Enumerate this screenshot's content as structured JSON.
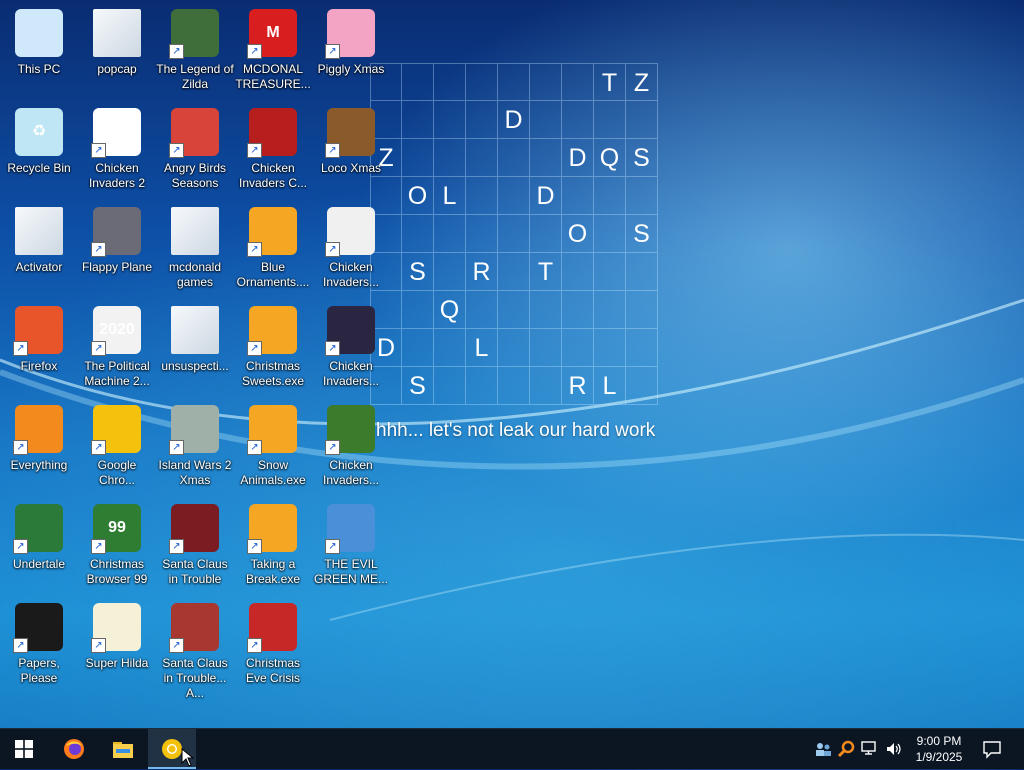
{
  "desktop": {
    "icons": [
      {
        "label": "This PC",
        "icon": "computer-icon",
        "color": "#cfe9fb",
        "glyph": "",
        "shortcut": false
      },
      {
        "label": "Recycle Bin",
        "icon": "recycle-bin-icon",
        "color": "#bfe6f5",
        "glyph": "♻",
        "shortcut": false
      },
      {
        "label": "Activator",
        "icon": "folder-icon",
        "color": "#e6eef5",
        "glyph": "",
        "shortcut": false
      },
      {
        "label": "Firefox",
        "icon": "firefox-icon",
        "color": "#e8552a",
        "glyph": "",
        "shortcut": true
      },
      {
        "label": "Everything",
        "icon": "magnifier-icon",
        "color": "#f28a1e",
        "glyph": "",
        "shortcut": true
      },
      {
        "label": "Undertale",
        "icon": "undertale-icon",
        "color": "#2c7a3a",
        "glyph": "",
        "shortcut": true
      },
      {
        "label": "Papers, Please",
        "icon": "papers-please-icon",
        "color": "#1a1a1a",
        "glyph": "",
        "shortcut": true
      },
      {
        "label": "popcap",
        "icon": "folder-icon",
        "color": "#e6eef5",
        "glyph": "",
        "shortcut": false
      },
      {
        "label": "Chicken Invaders 2",
        "icon": "chicken-icon",
        "color": "#ffffff",
        "glyph": "2",
        "shortcut": true
      },
      {
        "label": "Flappy Plane",
        "icon": "flappy-plane-icon",
        "color": "#6b6b78",
        "glyph": "",
        "shortcut": true
      },
      {
        "label": "The Political Machine 2...",
        "icon": "political-machine-icon",
        "color": "#f2f2f2",
        "glyph": "2020",
        "shortcut": true
      },
      {
        "label": "Google Chro...",
        "icon": "chrome-icon",
        "color": "#f4c20d",
        "glyph": "",
        "shortcut": true
      },
      {
        "label": "Christmas Browser 99",
        "icon": "christmas-tree-icon",
        "color": "#2f7d32",
        "glyph": "99",
        "shortcut": true
      },
      {
        "label": "Super Hilda",
        "icon": "super-hilda-icon",
        "color": "#f5f0d8",
        "glyph": "",
        "shortcut": true
      },
      {
        "label": "The Legend of Zilda",
        "icon": "zilda-icon",
        "color": "#3f6e3a",
        "glyph": "",
        "shortcut": true
      },
      {
        "label": "Angry Birds Seasons",
        "icon": "angry-birds-icon",
        "color": "#d8443a",
        "glyph": "",
        "shortcut": true
      },
      {
        "label": "mcdonald games",
        "icon": "folder-icon",
        "color": "#e6eef5",
        "glyph": "",
        "shortcut": false
      },
      {
        "label": "unsuspecti...",
        "icon": "folder-icon",
        "color": "#e6eef5",
        "glyph": "",
        "shortcut": false
      },
      {
        "label": "Island Wars 2 Xmas",
        "icon": "island-wars-icon",
        "color": "#9fb0a8",
        "glyph": "",
        "shortcut": true
      },
      {
        "label": "Santa Claus in Trouble",
        "icon": "santa-icon",
        "color": "#7a1c22",
        "glyph": "",
        "shortcut": true
      },
      {
        "label": "Santa Claus in Trouble... A...",
        "icon": "santa-icon",
        "color": "#a8382f",
        "glyph": "",
        "shortcut": true
      },
      {
        "label": "MCDONAL TREASURE...",
        "icon": "mcdonalds-icon",
        "color": "#d81e1e",
        "glyph": "M",
        "shortcut": true
      },
      {
        "label": "Chicken Invaders C...",
        "icon": "snowman-icon",
        "color": "#b71f1f",
        "glyph": "",
        "shortcut": true
      },
      {
        "label": "Blue Ornaments....",
        "icon": "puzzle-icon",
        "color": "#f5a623",
        "glyph": "",
        "shortcut": true
      },
      {
        "label": "Christmas Sweets.exe",
        "icon": "puzzle-icon",
        "color": "#f5a623",
        "glyph": "",
        "shortcut": true
      },
      {
        "label": "Snow Animals.exe",
        "icon": "puzzle-icon",
        "color": "#f5a623",
        "glyph": "",
        "shortcut": true
      },
      {
        "label": "Taking a Break.exe",
        "icon": "puzzle-icon",
        "color": "#f5a623",
        "glyph": "",
        "shortcut": true
      },
      {
        "label": "Christmas Eve Crisis",
        "icon": "santa-face-icon",
        "color": "#c62828",
        "glyph": "",
        "shortcut": true
      },
      {
        "label": "Piggly Xmas",
        "icon": "pig-icon",
        "color": "#f3a3c3",
        "glyph": "",
        "shortcut": true
      },
      {
        "label": "Loco Xmas",
        "icon": "bear-icon",
        "color": "#8b5a2b",
        "glyph": "",
        "shortcut": true
      },
      {
        "label": "Chicken Invaders...",
        "icon": "chicken-icon",
        "color": "#f0f0f0",
        "glyph": "",
        "shortcut": true
      },
      {
        "label": "Chicken Invaders...",
        "icon": "chicken-icon",
        "color": "#2a2540",
        "glyph": "",
        "shortcut": true
      },
      {
        "label": "Chicken Invaders...",
        "icon": "chicken-icon",
        "color": "#3c7a2c",
        "glyph": "",
        "shortcut": true
      },
      {
        "label": "THE EVIL GREEN ME...",
        "icon": "messenger-icon",
        "color": "#4a90d9",
        "glyph": "",
        "shortcut": true
      }
    ]
  },
  "grid": {
    "rows": [
      [
        "",
        "",
        "",
        "",
        "",
        "",
        "",
        "T",
        "Z"
      ],
      [
        "",
        "",
        "",
        "",
        "D",
        "",
        "",
        "",
        ""
      ],
      [
        "Z",
        "",
        "",
        "",
        "",
        "",
        "D",
        "Q",
        "S"
      ],
      [
        "",
        "O",
        "L",
        "",
        "",
        "D",
        "",
        "",
        ""
      ],
      [
        "",
        "",
        "",
        "",
        "",
        "",
        "O",
        "",
        "S"
      ],
      [
        "",
        "S",
        "",
        "R",
        "",
        "T",
        "",
        "",
        ""
      ],
      [
        "",
        "",
        "Q",
        "",
        "",
        "",
        "",
        "",
        ""
      ],
      [
        "D",
        "",
        "",
        "L",
        "",
        "",
        "",
        "",
        ""
      ],
      [
        "",
        "S",
        "",
        "",
        "",
        "",
        "R",
        "L",
        ""
      ]
    ]
  },
  "caption": "hhh... let's not leak our hard work",
  "taskbar": {
    "start_icon": "windows-logo-icon",
    "pinned": [
      {
        "name": "firefox-taskbar-icon",
        "label": "Firefox"
      },
      {
        "name": "file-explorer-taskbar-icon",
        "label": "File Explorer"
      },
      {
        "name": "chrome-taskbar-icon",
        "label": "Google Chrome"
      }
    ],
    "tray": {
      "icons": [
        "people-icon",
        "search-tray-icon",
        "network-icon",
        "volume-icon"
      ],
      "time": "9:00 PM",
      "date": "1/9/2025"
    },
    "notification_icon": "action-center-icon"
  }
}
